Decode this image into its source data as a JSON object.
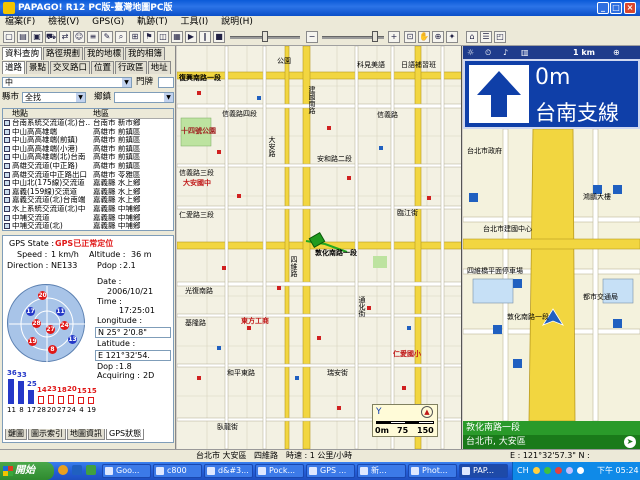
{
  "window": {
    "title": "PAPAGO! R12 PC版-臺灣地圖PC版"
  },
  "menu": [
    "檔案(F)",
    "檢視(V)",
    "GPS(G)",
    "軌跡(T)",
    "工具(I)",
    "說明(H)"
  ],
  "left_panel": {
    "tabs_top": [
      "資料查詢",
      "路徑規劃",
      "我的地標",
      "我的相簿"
    ],
    "tabs_second": [
      "道路",
      "景點",
      "交叉路口",
      "位置",
      "行政區",
      "地址"
    ],
    "road_type_value": "中",
    "gate_label": "門牌",
    "county_label": "縣市",
    "county_value": "全找",
    "township_label": "鄉鎮",
    "list_headers": [
      "地點",
      "地區"
    ],
    "list_rows": [
      [
        "台南系統交流道(北)台...",
        "台南市 新市鄉"
      ],
      [
        "中山高高雄端",
        "高雄市 前鎮區"
      ],
      [
        "中山高高雄端(前鎮)",
        "高雄市 前鎮區"
      ],
      [
        "中山高高雄端(小港)",
        "高雄市 前鎮區"
      ],
      [
        "中山高高雄端(北)台南",
        "高雄市 前鎮區"
      ],
      [
        "高雄交流道(中正路)",
        "高雄市 前鎮區"
      ],
      [
        "高雄交流道中正路出口",
        "高雄市 苓雅區"
      ],
      [
        "中山北(175線)交流道",
        "嘉義縣 水上鄉"
      ],
      [
        "嘉義(159線)交流道",
        "嘉義縣 水上鄉"
      ],
      [
        "嘉義交流道(北)台南端",
        "嘉義縣 水上鄉"
      ],
      [
        "水上系統交流道(北)中",
        "嘉義縣 中埔鄉"
      ],
      [
        "中埔交流道",
        "嘉義縣 中埔鄉"
      ],
      [
        "中埔交流道(北)",
        "嘉義縣 中埔鄉"
      ],
      [
        "中埔交流道(南)",
        "嘉義縣 中埔鄉"
      ]
    ],
    "gps": {
      "state_label": "GPS State :",
      "state_value": "GPS已正常定位",
      "speed_label": "Speed :",
      "speed_value": "1 km/h",
      "altitude_label": "Altitude :",
      "altitude_value": "36 m",
      "direction_label": "Direction :",
      "direction_value": "NE133",
      "pdop_label": "Pdop :",
      "pdop_value": "2.1",
      "date_label": "Date :",
      "date_value": "2006/10/21",
      "time_label": "Time :",
      "time_value": "17:25:01",
      "longitude_label": "Longitude :",
      "longitude_value": "N 25° 2'0.8\"",
      "latitude_label": "Latitude :",
      "latitude_value": "E 121°32'54.",
      "dop_label": "Dop :",
      "dop_value": "1.8",
      "acq_label": "Acquiring :",
      "acq_value": "2D",
      "sats_on_plot": [
        {
          "id": "20",
          "color": "red"
        },
        {
          "id": "17",
          "color": "blue"
        },
        {
          "id": "11",
          "color": "blue"
        },
        {
          "id": "28",
          "color": "red"
        },
        {
          "id": "24",
          "color": "red"
        },
        {
          "id": "27",
          "color": "red"
        },
        {
          "id": "13",
          "color": "blue"
        },
        {
          "id": "19",
          "color": "red"
        },
        {
          "id": "8",
          "color": "red"
        }
      ],
      "bars": [
        {
          "top": "36",
          "bottom": "11",
          "color": "blue",
          "level": 0.95
        },
        {
          "top": "33",
          "bottom": "8",
          "color": "blue",
          "level": 0.88
        },
        {
          "top": "25",
          "bottom": "17",
          "color": "blue",
          "level": 0.55
        },
        {
          "top": "14",
          "bottom": "28",
          "color": "red",
          "level": 0.32
        },
        {
          "top": "23",
          "bottom": "20",
          "color": "red",
          "level": 0.35
        },
        {
          "top": "18",
          "bottom": "27",
          "color": "red",
          "level": 0.3
        },
        {
          "top": "20",
          "bottom": "24",
          "color": "red",
          "level": 0.33
        },
        {
          "top": "15",
          "bottom": "4",
          "color": "red",
          "level": 0.28
        },
        {
          "top": "15",
          "bottom": "19",
          "color": "red",
          "level": 0.28
        }
      ]
    },
    "bottom_tabs": [
      "鍵圖",
      "圖示索引",
      "地圖資訊",
      "GPS狀態"
    ]
  },
  "map": {
    "labels": {
      "l1": "公園",
      "l2": "科見美語",
      "l3": "日語補習班",
      "l4": "復興南路一段",
      "l5": "信義路四段",
      "l6": "信義路三段",
      "l7": "十四號公園",
      "l8": "建國南路",
      "l9": "大安國中",
      "l10": "仁愛路三段",
      "l11": "大安路",
      "l12": "安和路二段",
      "l13": "信義路",
      "l14": "敦化南路一段",
      "l15": "東方工商",
      "l16": "仁愛國小",
      "l17": "四維路",
      "l18": "通化街",
      "l19": "光復南路",
      "l20": "基隆路",
      "l21": "和平東路",
      "l22": "瑞安街",
      "l23": "臥龍街",
      "l24": "臨江街"
    },
    "scale_text": "0m",
    "scale_mid": "75",
    "scale_end": "150"
  },
  "nav": {
    "scale": "1 km",
    "distance": "0m",
    "next_road": "台南支線",
    "labels": [
      "台北市政府",
      "四維橋平面停車場",
      "敦化南路一段",
      "台北市建國中心",
      "鴻鵬大樓",
      "都市交通局"
    ],
    "current_road": "敦化南路一段",
    "current_area": "台北市, 大安區",
    "bottom_right": "E : 121°32'57.3\"  N : 25°01'51.0\""
  },
  "status": {
    "area": "台北市 大安區",
    "road": "四維路",
    "speed": "時速 : 1 公里/小時",
    "coords": "E : 121°32'57.3\"  N : 25°01'51.0\""
  },
  "taskbar": {
    "start": "開始",
    "tasks": [
      "Goo...",
      "c800",
      "d&#3...",
      "Pock...",
      "GPS ...",
      "新...",
      "Phot...",
      "PAP..."
    ],
    "lang": "CH",
    "clock": "下午 05:24"
  },
  "colors": {
    "title_blue": "#0a5ad8",
    "nav_blue": "#0f3fa8",
    "nav_green": "#2a9a2a",
    "road_yellow": "#f2d640",
    "sat_red": "#e01818",
    "sat_blue": "#2438c8"
  }
}
